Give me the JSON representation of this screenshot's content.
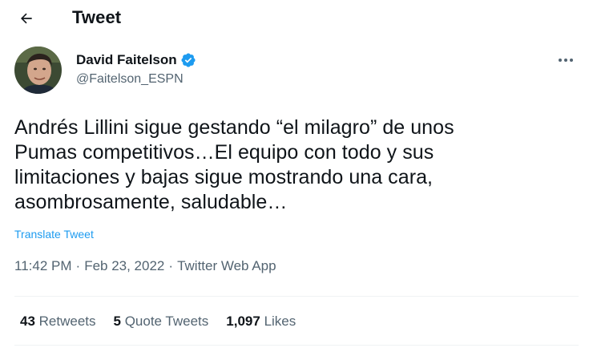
{
  "header": {
    "back_icon": "arrow-left-icon",
    "title": "Tweet"
  },
  "author": {
    "name": "David Faitelson",
    "handle": "@Faitelson_ESPN",
    "verified_icon": "verified-badge-icon",
    "verified_color": "#1d9bf0"
  },
  "tweet": {
    "text": "Andrés Lillini sigue gestando “el milagro” de unos\nPumas competitivos…El equipo con todo y sus\nlimitaciones y bajas sigue mostrando una cara,\nasombrosamente, saludable…",
    "translate_label": "Translate Tweet",
    "time": "11:42 PM",
    "separator": "·",
    "date": "Feb 23, 2022",
    "app": "Twitter Web App"
  },
  "stats": {
    "retweets_count": "43",
    "retweets_label": "Retweets",
    "quotes_count": "5",
    "quotes_label": "Quote Tweets",
    "likes_count": "1,097",
    "likes_label": "Likes"
  },
  "colors": {
    "accent": "#1d9bf0",
    "text_primary": "#0f1419",
    "text_secondary": "#536471",
    "divider": "#eff3f4"
  }
}
